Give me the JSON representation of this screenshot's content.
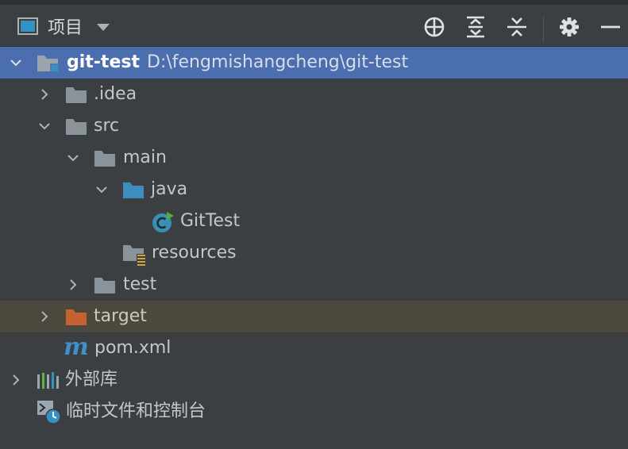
{
  "header": {
    "title": "项目",
    "tools": [
      "locate-icon",
      "expand-all-icon",
      "collapse-all-icon",
      "gear-icon",
      "minimize-icon"
    ]
  },
  "colors": {
    "background": "#3c3f41",
    "selection": "#4b6eaf",
    "excluded_row": "#4d483d",
    "folder_gray": "#8a9399",
    "source_folder_blue": "#3a8fbd",
    "excluded_folder_orange": "#c4632f",
    "class_icon_teal": "#3b8fb0",
    "maven_blue": "#3d90c9"
  },
  "tree": {
    "root": {
      "name": "git-test",
      "path": "D:\\fengmishangcheng\\git-test",
      "expanded": true,
      "selected": true
    },
    "idea": {
      "name": ".idea",
      "expanded": false
    },
    "src": {
      "name": "src",
      "expanded": true
    },
    "main": {
      "name": "main",
      "expanded": true
    },
    "java": {
      "name": "java",
      "expanded": true
    },
    "gittest": {
      "name": "GitTest"
    },
    "resources": {
      "name": "resources"
    },
    "test": {
      "name": "test",
      "expanded": false
    },
    "target": {
      "name": "target",
      "expanded": false
    },
    "pom": {
      "name": "pom.xml"
    },
    "external_libs": {
      "name": "外部库",
      "expanded": false
    },
    "scratches": {
      "name": "临时文件和控制台"
    }
  }
}
